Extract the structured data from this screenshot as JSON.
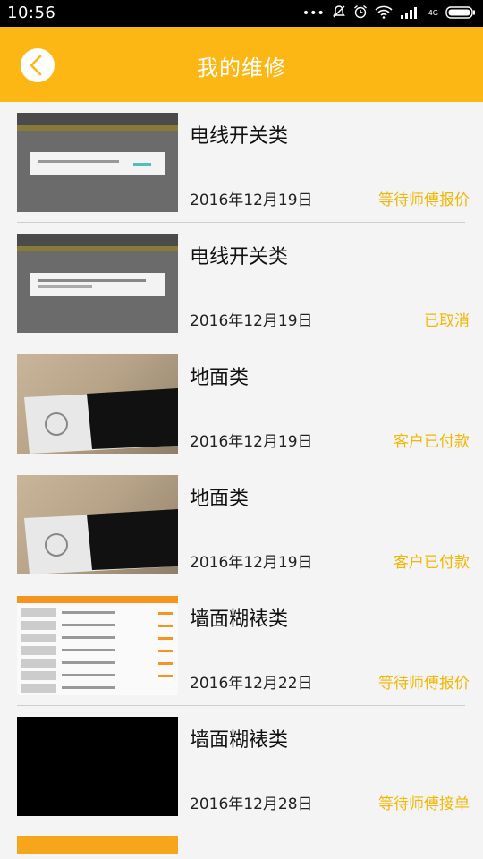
{
  "status_bar": {
    "time": "10:56",
    "network": "4G"
  },
  "header": {
    "title": "我的维修"
  },
  "orders": [
    {
      "category": "电线开关类",
      "date": "2016年12月19日",
      "status": "等待师傅报价"
    },
    {
      "category": "电线开关类",
      "date": "2016年12月19日",
      "status": "已取消"
    },
    {
      "category": "地面类",
      "date": "2016年12月19日",
      "status": "客户已付款"
    },
    {
      "category": "地面类",
      "date": "2016年12月19日",
      "status": "客户已付款"
    },
    {
      "category": "墙面糊裱类",
      "date": "2016年12月22日",
      "status": "等待师傅报价"
    },
    {
      "category": "墙面糊裱类",
      "date": "2016年12月28日",
      "status": "等待师傅接单"
    }
  ],
  "colors": {
    "accent": "#fdb714",
    "status_text": "#f2b705"
  }
}
